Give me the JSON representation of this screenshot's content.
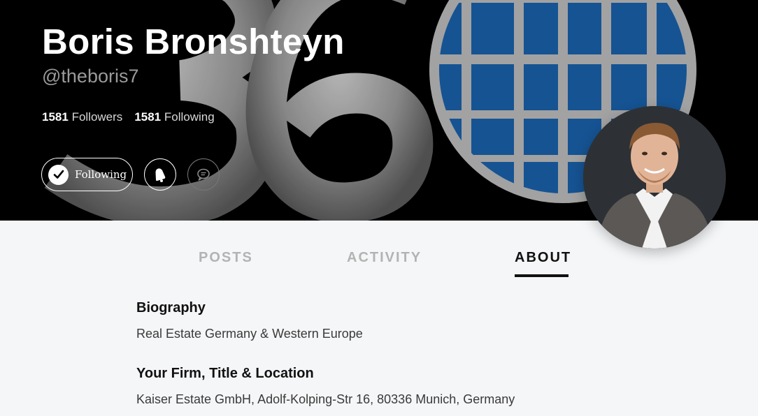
{
  "profile": {
    "name": "Boris Bronshteyn",
    "handle": "@theboris7",
    "followers_count": "1581",
    "followers_label": "Followers",
    "following_count": "1581",
    "following_label": "Following"
  },
  "actions": {
    "follow_label": "Following",
    "icons": [
      "check-icon",
      "bell-icon",
      "message-icon"
    ]
  },
  "tabs": [
    {
      "label": "POSTS",
      "active": false
    },
    {
      "label": "ACTIVITY",
      "active": false
    },
    {
      "label": "ABOUT",
      "active": true
    }
  ],
  "about": {
    "biography_title": "Biography",
    "biography_text": "Real Estate Germany & Western Europe",
    "firm_title": "Your Firm, Title & Location",
    "firm_text": "Kaiser Estate GmbH, Adolf-Kolping-Str 16, 80336 Munich, Germany"
  },
  "colors": {
    "hero_background": "#000000",
    "globe_blue": "#1a5fa8",
    "page_background": "#f5f6f8",
    "active_tab": "#111111",
    "inactive_tab": "#b3b3b3"
  }
}
